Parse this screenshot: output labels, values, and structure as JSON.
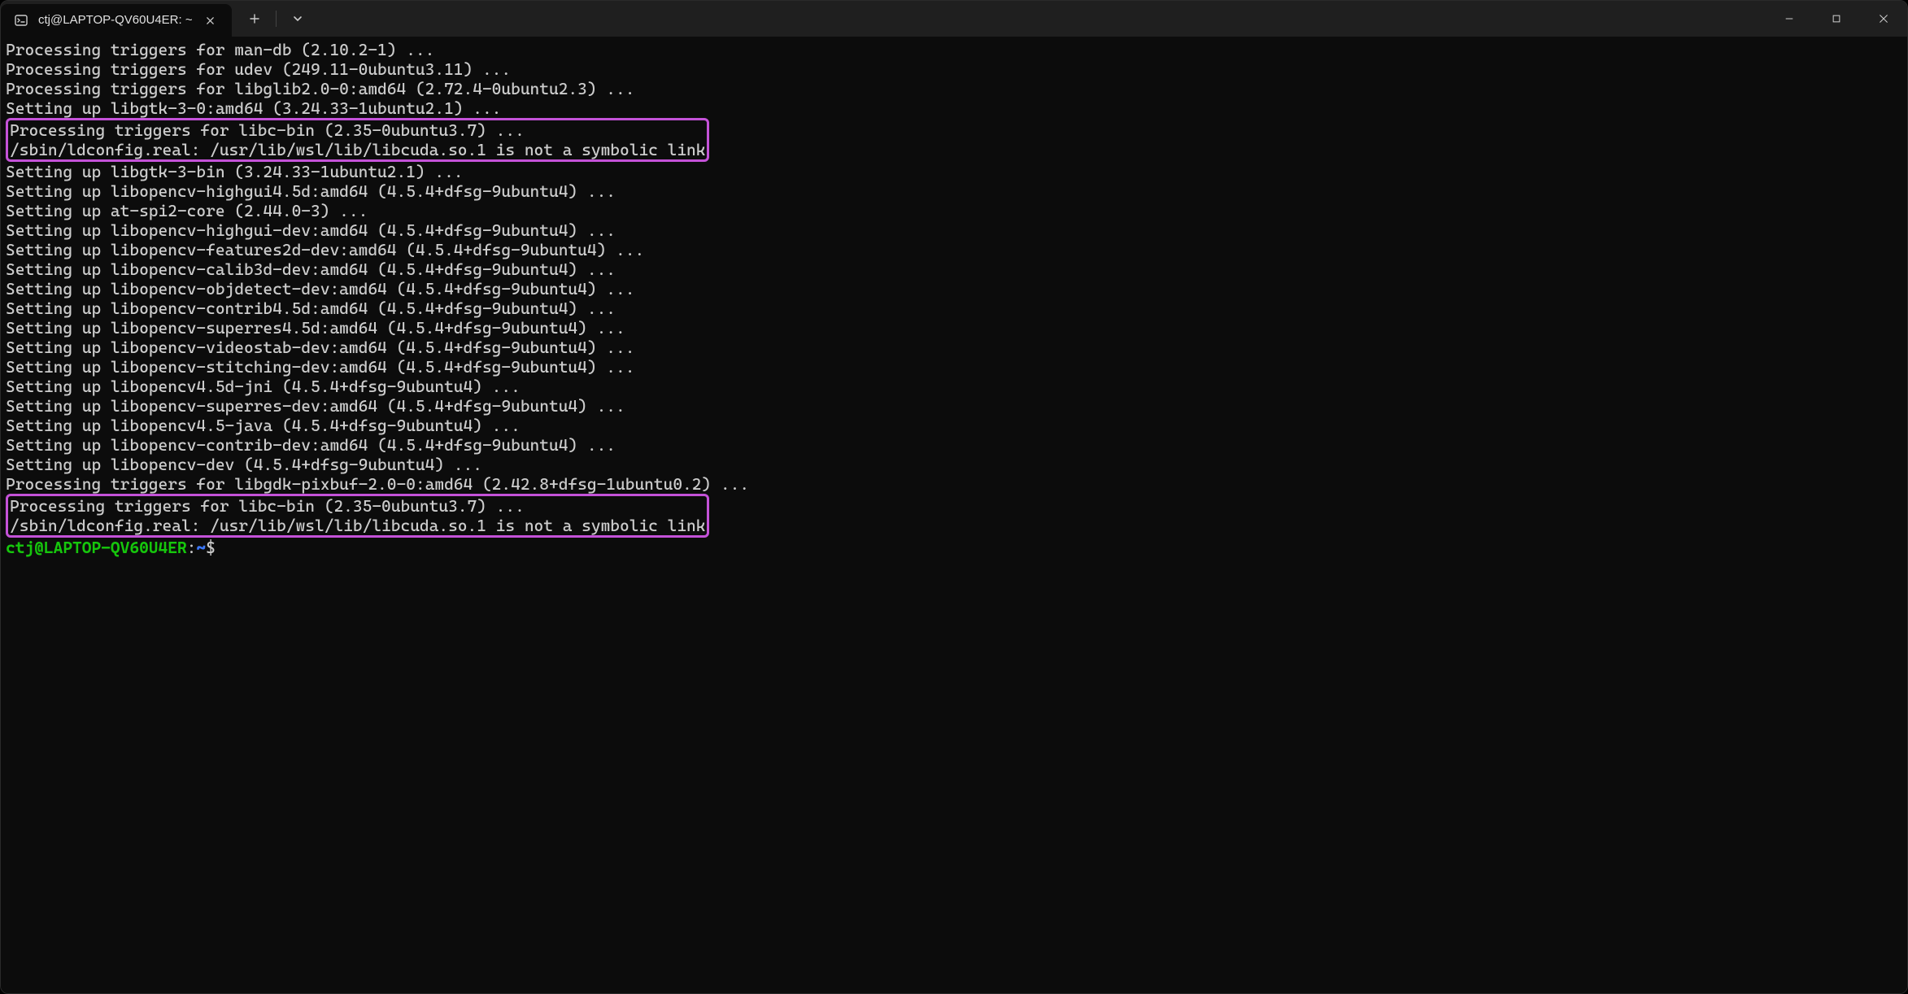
{
  "titlebar": {
    "tab_title": "ctj@LAPTOP-QV60U4ER: ~",
    "tab_icon": "terminal-icon",
    "new_tab_label": "+",
    "dropdown_label": "⌄"
  },
  "window_controls": {
    "minimize": "—",
    "maximize": "□",
    "close": "✕"
  },
  "terminal": {
    "lines": [
      "Processing triggers for man-db (2.10.2-1) ...",
      "Processing triggers for udev (249.11-0ubuntu3.11) ...",
      "Processing triggers for libglib2.0-0:amd64 (2.72.4-0ubuntu2.3) ...",
      "Setting up libgtk-3-0:amd64 (3.24.33-1ubuntu2.1) ..."
    ],
    "highlight1": [
      "Processing triggers for libc-bin (2.35-0ubuntu3.7) ...",
      "/sbin/ldconfig.real: /usr/lib/wsl/lib/libcuda.so.1 is not a symbolic link"
    ],
    "blank1": "",
    "lines2": [
      "Setting up libgtk-3-bin (3.24.33-1ubuntu2.1) ...",
      "Setting up libopencv-highgui4.5d:amd64 (4.5.4+dfsg-9ubuntu4) ...",
      "Setting up at-spi2-core (2.44.0-3) ...",
      "Setting up libopencv-highgui-dev:amd64 (4.5.4+dfsg-9ubuntu4) ...",
      "Setting up libopencv-features2d-dev:amd64 (4.5.4+dfsg-9ubuntu4) ...",
      "Setting up libopencv-calib3d-dev:amd64 (4.5.4+dfsg-9ubuntu4) ...",
      "Setting up libopencv-objdetect-dev:amd64 (4.5.4+dfsg-9ubuntu4) ...",
      "Setting up libopencv-contrib4.5d:amd64 (4.5.4+dfsg-9ubuntu4) ...",
      "Setting up libopencv-superres4.5d:amd64 (4.5.4+dfsg-9ubuntu4) ...",
      "Setting up libopencv-videostab-dev:amd64 (4.5.4+dfsg-9ubuntu4) ...",
      "Setting up libopencv-stitching-dev:amd64 (4.5.4+dfsg-9ubuntu4) ...",
      "Setting up libopencv4.5d-jni (4.5.4+dfsg-9ubuntu4) ...",
      "Setting up libopencv-superres-dev:amd64 (4.5.4+dfsg-9ubuntu4) ...",
      "Setting up libopencv4.5-java (4.5.4+dfsg-9ubuntu4) ...",
      "Setting up libopencv-contrib-dev:amd64 (4.5.4+dfsg-9ubuntu4) ...",
      "Setting up libopencv-dev (4.5.4+dfsg-9ubuntu4) ...",
      "Processing triggers for libgdk-pixbuf-2.0-0:amd64 (2.42.8+dfsg-1ubuntu0.2) ..."
    ],
    "highlight2": [
      "Processing triggers for libc-bin (2.35-0ubuntu3.7) ...",
      "/sbin/ldconfig.real: /usr/lib/wsl/lib/libcuda.so.1 is not a symbolic link"
    ],
    "blank2": "",
    "prompt": {
      "user_host": "ctj@LAPTOP-QV60U4ER",
      "colon": ":",
      "path": "~",
      "dollar": "$"
    }
  }
}
